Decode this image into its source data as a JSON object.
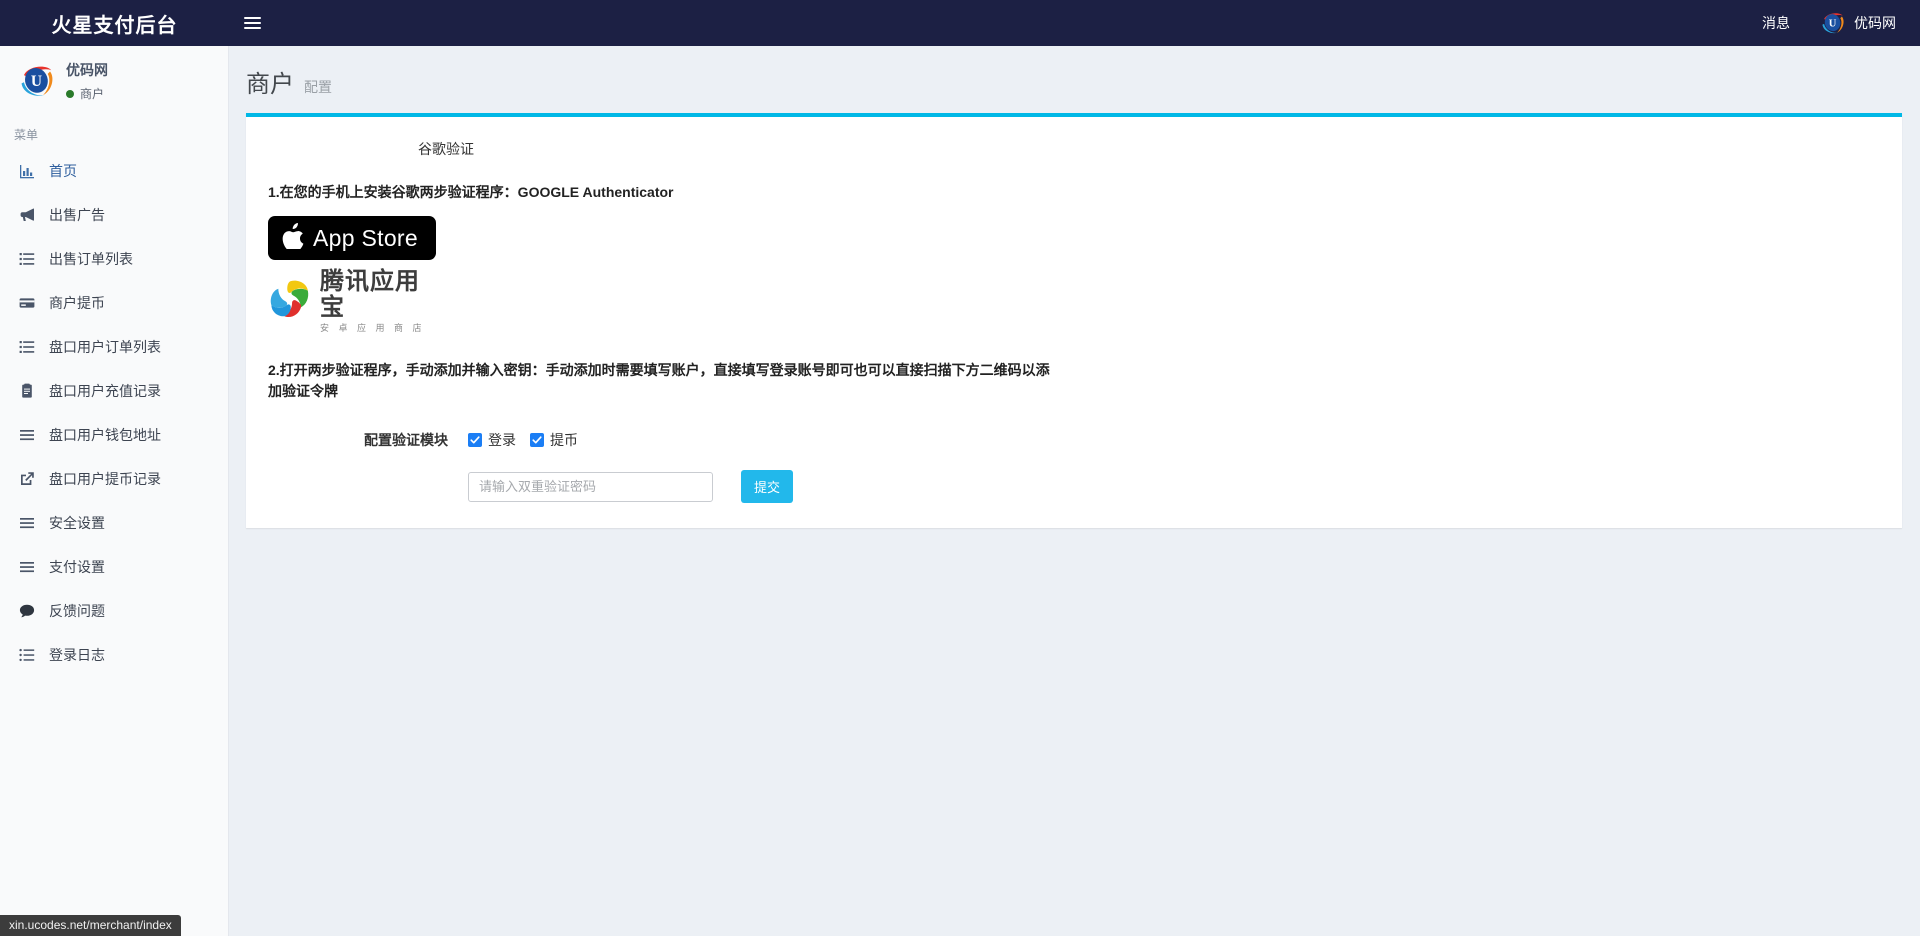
{
  "navbar": {
    "brand": "火星支付后台",
    "menu_toggle_icon": "hamburger-icon",
    "messages_label": "消息",
    "user_name": "优码网",
    "user_logo_icon": "ucodes-u-logo-icon",
    "bg_color": "#1c2044"
  },
  "sidebar": {
    "profile": {
      "name": "优码网",
      "role": "商户",
      "status_color": "#2a7a2a",
      "logo_icon": "ucodes-u-logo-icon"
    },
    "section_header": "菜单",
    "items": [
      {
        "label": "首页",
        "icon": "bar-chart-icon",
        "active": true
      },
      {
        "label": "出售广告",
        "icon": "bullhorn-icon",
        "active": false
      },
      {
        "label": "出售订单列表",
        "icon": "list-icon",
        "active": false
      },
      {
        "label": "商户提币",
        "icon": "credit-card-icon",
        "active": false
      },
      {
        "label": "盘口用户订单列表",
        "icon": "list-icon",
        "active": false
      },
      {
        "label": "盘口用户充值记录",
        "icon": "clipboard-icon",
        "active": false
      },
      {
        "label": "盘口用户钱包地址",
        "icon": "bars-icon",
        "active": false
      },
      {
        "label": "盘口用户提币记录",
        "icon": "external-link-icon",
        "active": false
      },
      {
        "label": "安全设置",
        "icon": "bars-icon",
        "active": false
      },
      {
        "label": "支付设置",
        "icon": "bars-icon",
        "active": false
      },
      {
        "label": "反馈问题",
        "icon": "comment-icon",
        "active": false
      },
      {
        "label": "登录日志",
        "icon": "list-ul-icon",
        "active": false
      }
    ]
  },
  "page": {
    "title": "商户",
    "subtitle": "配置",
    "card_accent_color": "#00b8e6"
  },
  "card": {
    "section_title": "谷歌验证",
    "step1": "1.在您的手机上安装谷歌两步验证程序：GOOGLE Authenticator",
    "appstore": {
      "label": "App Store",
      "icon": "apple-icon",
      "bg_color": "#000000"
    },
    "tencent": {
      "main": "腾讯应用宝",
      "sub": "安 卓 应 用 商 店",
      "icon": "tencent-myapp-logo-icon"
    },
    "step2": "2.打开两步验证程序，手动添加并输入密钥：手动添加时需要填写账户，直接填写登录账号即可也可以直接扫描下方二维码以添加验证令牌",
    "form": {
      "module_label": "配置验证模块",
      "checkboxes": [
        {
          "label": "登录",
          "checked": true
        },
        {
          "label": "提币",
          "checked": true
        }
      ],
      "password_placeholder": "请输入双重验证密码",
      "password_value": "",
      "submit_label": "提交",
      "submit_color": "#22b8eb",
      "checkbox_color": "#1b7ef5"
    }
  },
  "statusbar": {
    "url": "xin.ucodes.net/merchant/index"
  }
}
